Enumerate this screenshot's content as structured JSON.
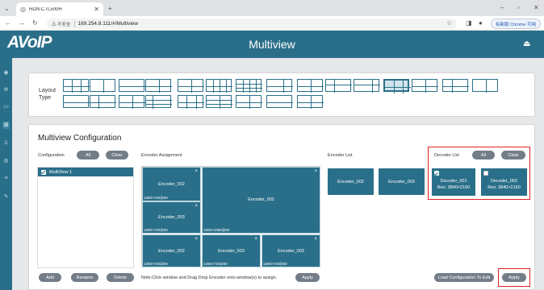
{
  "browser": {
    "tab_title": "HDN-CTL500H",
    "new_tab": "+",
    "security": "不安全",
    "url": "169.254.8.111/#/Multiview",
    "update_label": "有新版 Chrome 可用"
  },
  "app": {
    "logo": "AVoIP",
    "page_title": "Multiview"
  },
  "layout": {
    "label_line1": "Layout",
    "label_line2": "Type"
  },
  "config": {
    "title": "Multiview Configuration",
    "configuration_label": "Configuration",
    "all_label": "All",
    "clear_label": "Clear",
    "item": "MultiView 1",
    "add_label": "Add",
    "rename_label": "Rename",
    "delete_label": "Delete"
  },
  "assignment": {
    "label": "Encoder Assignment",
    "note": "Note:Click window and Drag Drop Encoder onto window(s) to assign.",
    "apply_label": "Apply",
    "windows": [
      {
        "name": "Encoder_002",
        "res": "1280×720@60"
      },
      {
        "name": "Encoder_002",
        "res": "1920×1080@60"
      },
      {
        "name": "Encoder_003",
        "res": "1280×720@60"
      },
      {
        "name": "Encoder_002",
        "res": "1280×720@60"
      },
      {
        "name": "Encoder_003",
        "res": "1280×720@60"
      },
      {
        "name": "Encoder_003",
        "res": "1280×720@60"
      }
    ],
    "close_glyph": "×"
  },
  "encoder_list": {
    "label": "Encoder List",
    "items": [
      "Encoder_002",
      "Encoder_003"
    ]
  },
  "decoder_list": {
    "label": "Decoder List",
    "all_label": "All",
    "clear_label": "Clear",
    "items": [
      {
        "name": "Decoder_001",
        "res": "Res: 3840×2160",
        "checked": true
      },
      {
        "name": "Decoder_002",
        "res": "Res: 3840×2160",
        "checked": false
      }
    ]
  },
  "bottom": {
    "load_label": "Load Configuration To Edit",
    "apply_label": "Apply"
  },
  "icons": {
    "menu": "chevron-down-icon",
    "back": "back-arrow-icon",
    "forward": "forward-arrow-icon",
    "reload": "reload-icon",
    "star": "star-icon",
    "logout": "logout-icon"
  },
  "colors": {
    "accent": "#2a6f89",
    "highlight": "#dd2222",
    "button": "#737d88"
  }
}
